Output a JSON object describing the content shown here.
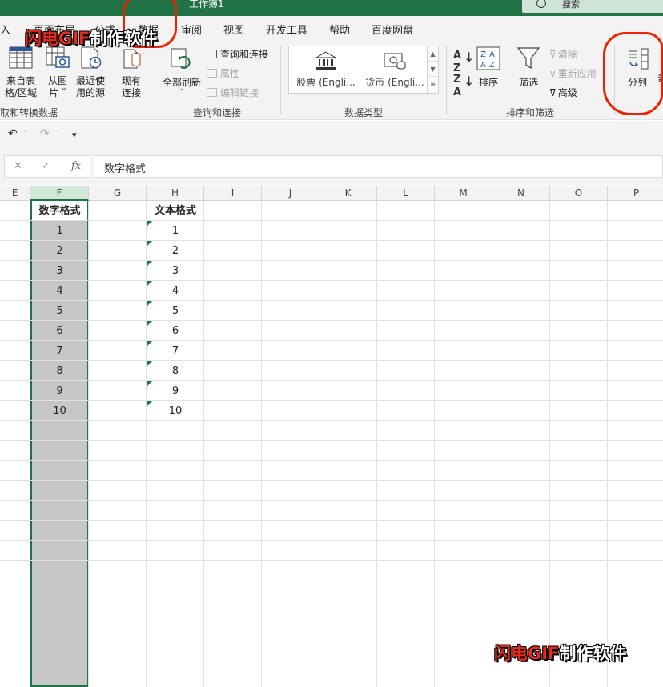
{
  "titlebar": {
    "title": "工作簿1",
    "search_placeholder": "搜索"
  },
  "tabs": [
    "入",
    "页面布局",
    "公式",
    "数据",
    "审阅",
    "视图",
    "开发工具",
    "帮助",
    "百度网盘"
  ],
  "ribbon": {
    "get_transform": {
      "btn_from_table": "来自表\n格/区域",
      "btn_from_picture": "从图\n片 ˅",
      "btn_recent": "最近使\n用的源",
      "btn_existing": "现有\n连接",
      "group_label": "取和转换数据"
    },
    "queries": {
      "refresh_all": "全部刷新",
      "queries_connections": "查询和连接",
      "properties": "属性",
      "edit_links": "编辑链接",
      "group_label": "查询和连接"
    },
    "data_types": {
      "stocks": "股票 (Engli...",
      "currencies": "货币 (Engli...",
      "group_label": "数据类型"
    },
    "sort_filter": {
      "sort": "排序",
      "filter": "筛选",
      "clear": "清除",
      "reapply": "重新应用",
      "advanced": "高级",
      "group_label": "排序和筛选"
    },
    "tools": {
      "text_to_columns": "分列",
      "next_partial": "素"
    }
  },
  "formula_bar": {
    "cancel": "✕",
    "enter": "✓",
    "fx": "fx",
    "value": "数字格式"
  },
  "columns": [
    "E",
    "F",
    "G",
    "H",
    "I",
    "J",
    "K",
    "L",
    "M",
    "N",
    "O",
    "P"
  ],
  "selected_column": "F",
  "sheet": {
    "f_header": "数字格式",
    "h_header": "文本格式",
    "f_values": [
      "1",
      "2",
      "3",
      "4",
      "5",
      "6",
      "7",
      "8",
      "9",
      "10"
    ],
    "h_values": [
      "1",
      "2",
      "3",
      "4",
      "5",
      "6",
      "7",
      "8",
      "9",
      "10"
    ]
  },
  "watermark": {
    "red": "闪电GIF",
    "white": "制作软件"
  },
  "colors": {
    "accent": "#217346",
    "annotation": "#EE2200",
    "selection_fill": "#C6C6C6"
  }
}
